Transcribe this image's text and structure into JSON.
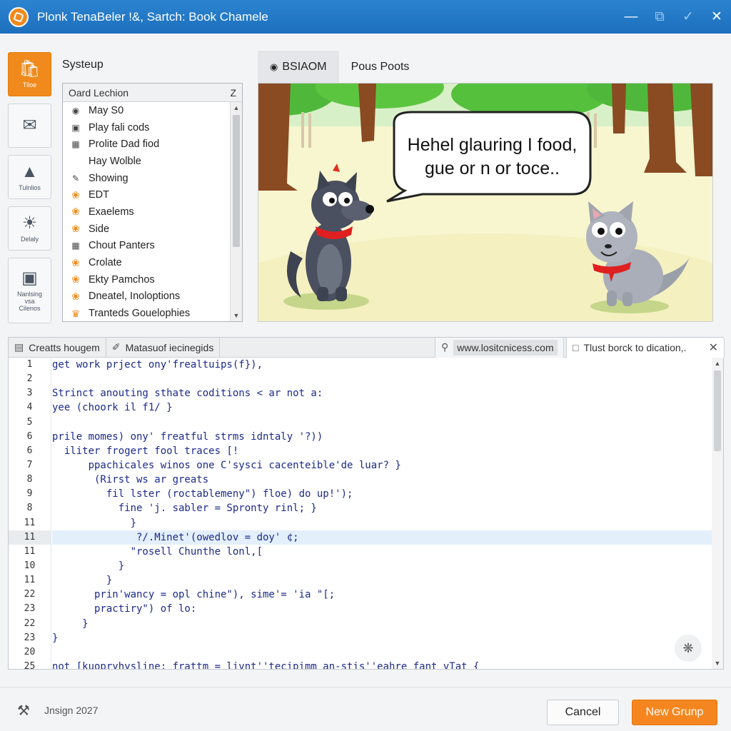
{
  "window": {
    "title": "Plonk TenaBeler !&, Sartch: Book Chamele",
    "controls": [
      "minimize",
      "restore",
      "check",
      "close"
    ]
  },
  "rail": {
    "items": [
      {
        "icon": "bag-icon",
        "label": "Tiloe",
        "active": true
      },
      {
        "icon": "mail-icon",
        "label": ""
      },
      {
        "icon": "person-icon",
        "label": "Tulnlios"
      },
      {
        "icon": "bulb-icon",
        "label": "Delaly"
      },
      {
        "icon": "projector-icon",
        "label": "Nanlsing\nvsa\nCilenos"
      }
    ]
  },
  "list_panel": {
    "title": "Systeup",
    "header": "Oard Lechion",
    "header_icon": "Z",
    "items": [
      {
        "label": "May S0",
        "icon": "eye-icon"
      },
      {
        "label": "Play fali cods",
        "icon": "lock-icon"
      },
      {
        "label": "Prolite Dad fiod",
        "icon": "grid-icon"
      },
      {
        "label": "Hay Wolble",
        "icon": ""
      },
      {
        "label": "Showing",
        "icon": "edit-icon"
      },
      {
        "label": "EDT",
        "icon": "flame-icon"
      },
      {
        "label": "Exaelems",
        "icon": "flame-icon"
      },
      {
        "label": "Side",
        "icon": "flame-icon"
      },
      {
        "label": "Chout Panters",
        "icon": "grid-icon"
      },
      {
        "label": "Crolate",
        "icon": "flame-icon"
      },
      {
        "label": "Ekty Pamchos",
        "icon": "flame-icon"
      },
      {
        "label": "Dneatel, Inoloptions",
        "icon": "flame-icon"
      },
      {
        "label": "Tranteds Gouelophies",
        "icon": "crown-icon"
      }
    ]
  },
  "preview": {
    "tabs": [
      {
        "label": "BSIAOM",
        "icon": "eye-icon",
        "active": true
      },
      {
        "label": "Pous Poots",
        "active": false
      }
    ],
    "speech": [
      "Hehel glauring I food,",
      "gue or n or toce.."
    ]
  },
  "editor": {
    "tabs": [
      {
        "label": "Creatts hougem",
        "icon": "terminal-icon"
      },
      {
        "label": "Matasuof iecinegids",
        "icon": "link-icon"
      }
    ],
    "url": "www.lositcnicess.com",
    "path_tab": "Tlust borck to dication,.",
    "line_numbers": [
      "1",
      "2",
      "3",
      "4",
      "5",
      "6",
      "6",
      "7",
      "8",
      "9",
      "8",
      "11",
      "11",
      "11",
      "10",
      "11",
      "22",
      "23",
      "22",
      "23",
      "20",
      "25"
    ],
    "highlight_index": 12,
    "lines": [
      "get work prject ony'frealtuips(f}),",
      "",
      "Strinct anouting sthate coditions < ar not a:",
      "yee (choork il f1/ }",
      "",
      "prile momes) ony' freatful strms idntaly '?))",
      "  iliter frogert fool traces [!",
      "      ppachicales winos one C'sysci cacenteible'de luar? }",
      "       (Rirst ws ar greats",
      "         fil lster (roctablemeny\") floe) do up!');",
      "           fine 'j. sabler = Spronty rinl; }",
      "             }",
      "              ?/.Minet'(owedlov = doy' ¢;",
      "             \"rosell Chunthe lonl,[",
      "           }",
      "         }",
      "       prin'wancy = opl chine\"), sime'= 'ia \"[;",
      "       practiry\") of lo:",
      "     }",
      "}",
      "",
      "not [kuopryhysline: frattm = livnt''tecipimm an-stis''eahre fant vTat {"
    ]
  },
  "footer": {
    "text": "Jnsign 2027",
    "cancel_label": "Cancel",
    "primary_label": "New Grunp",
    "accent": "#f5861f"
  }
}
